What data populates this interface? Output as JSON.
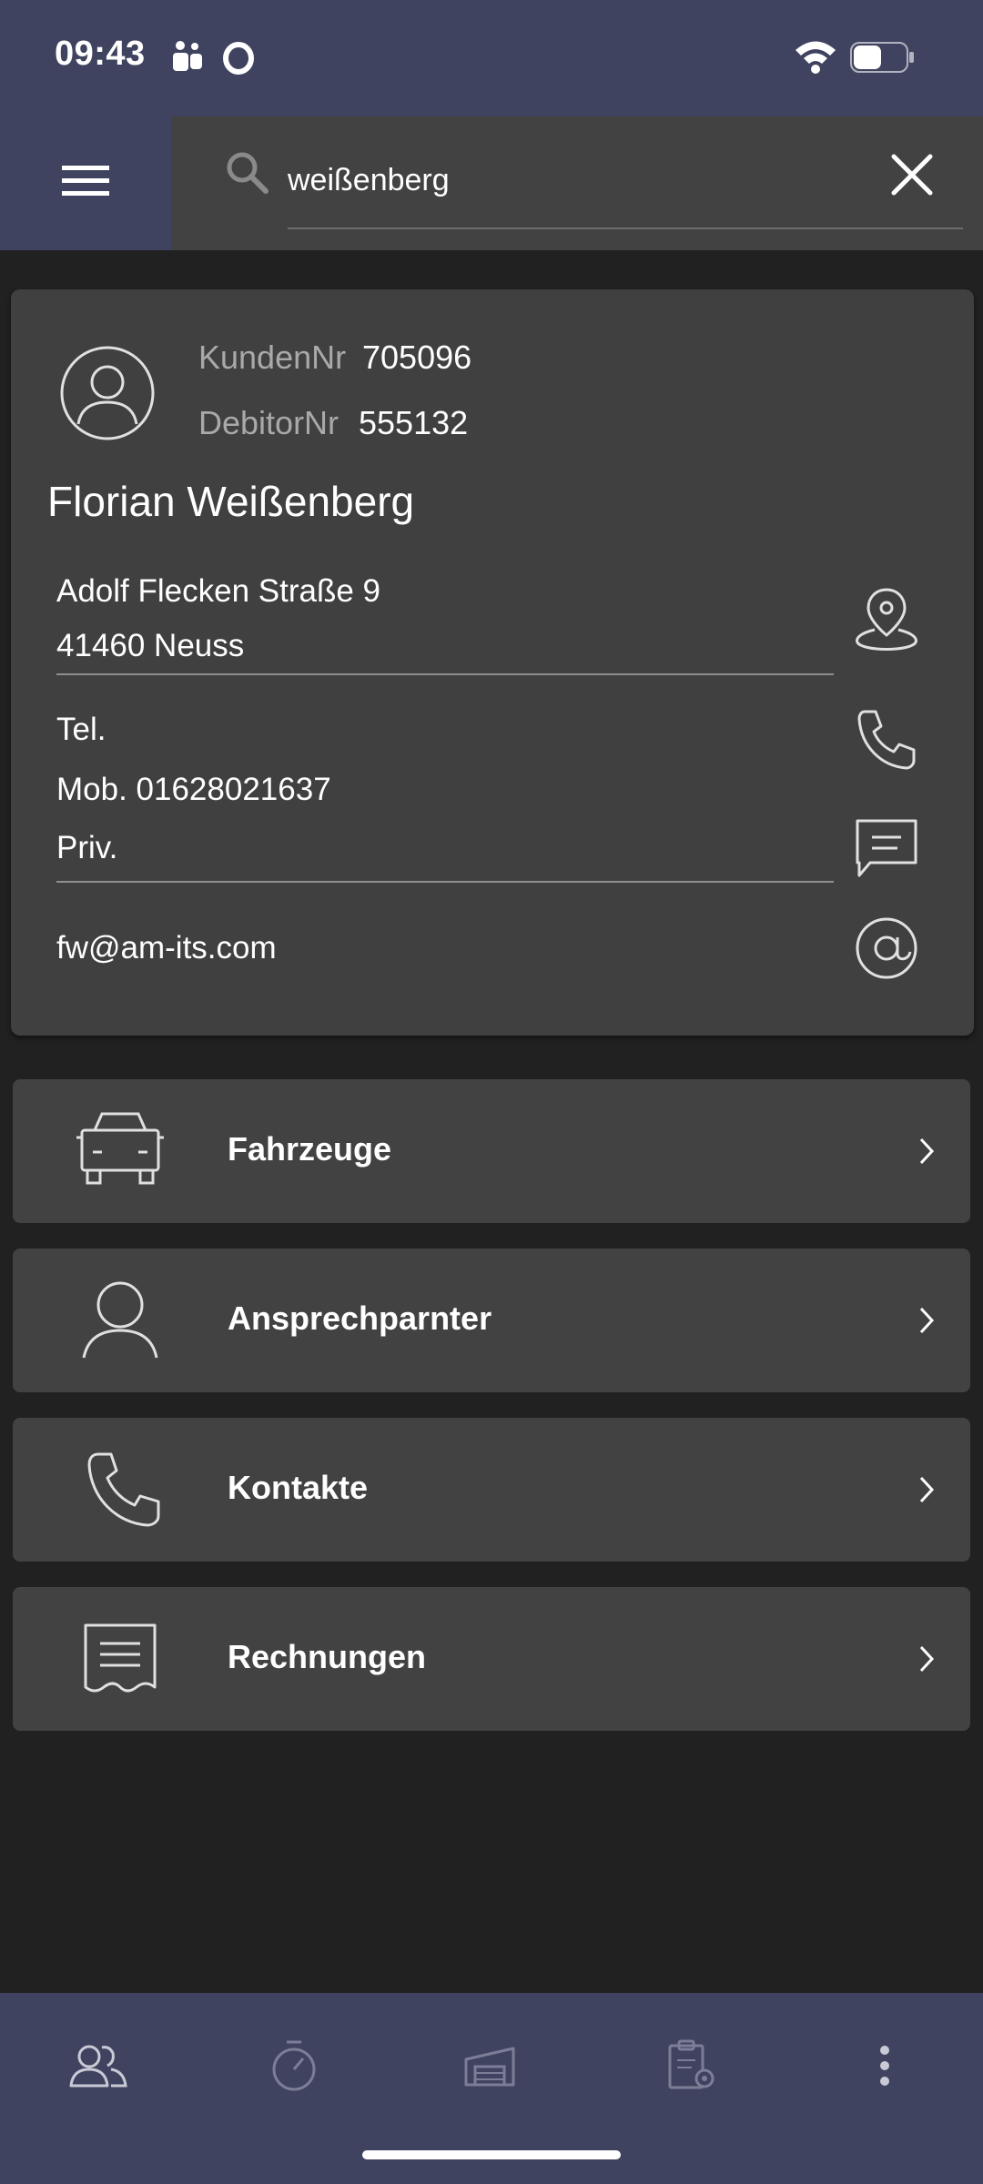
{
  "status_bar": {
    "time": "09:43",
    "icons": [
      "teams-icon",
      "opera-icon",
      "wifi-icon",
      "battery-icon"
    ]
  },
  "header": {
    "menu_icon": "hamburger-menu-icon",
    "search": {
      "icon": "search-icon",
      "value": "weißenberg",
      "clear_icon": "close-icon"
    }
  },
  "customer": {
    "avatar_icon": "user-circle-icon",
    "kunden_label": "KundenNr",
    "kunden_value": "705096",
    "debitor_label": "DebitorNr",
    "debitor_value": "555132",
    "name": "Florian Weißenberg",
    "address": {
      "street": "Adolf Flecken Straße 9",
      "city": "41460 Neuss",
      "icon": "map-pin-icon"
    },
    "phones": {
      "tel": "Tel.",
      "mob": "Mob. 01628021637",
      "priv": "Priv.",
      "call_icon": "phone-icon",
      "message_icon": "message-icon"
    },
    "email": {
      "value": "fw@am-its.com",
      "icon": "at-icon"
    }
  },
  "menu": [
    {
      "label": "Fahrzeuge",
      "icon": "car-icon"
    },
    {
      "label": "Ansprechparnter",
      "icon": "person-icon"
    },
    {
      "label": "Kontakte",
      "icon": "phone-icon"
    },
    {
      "label": "Rechnungen",
      "icon": "receipt-icon"
    }
  ],
  "bottom_nav": [
    "customers-icon",
    "stopwatch-icon",
    "garage-icon",
    "clipboard-settings-icon",
    "more-vertical-icon"
  ],
  "colors": {
    "accent": "#40435f",
    "background": "#212121",
    "surface": "#404040",
    "muted_text": "#a9a9a9"
  }
}
